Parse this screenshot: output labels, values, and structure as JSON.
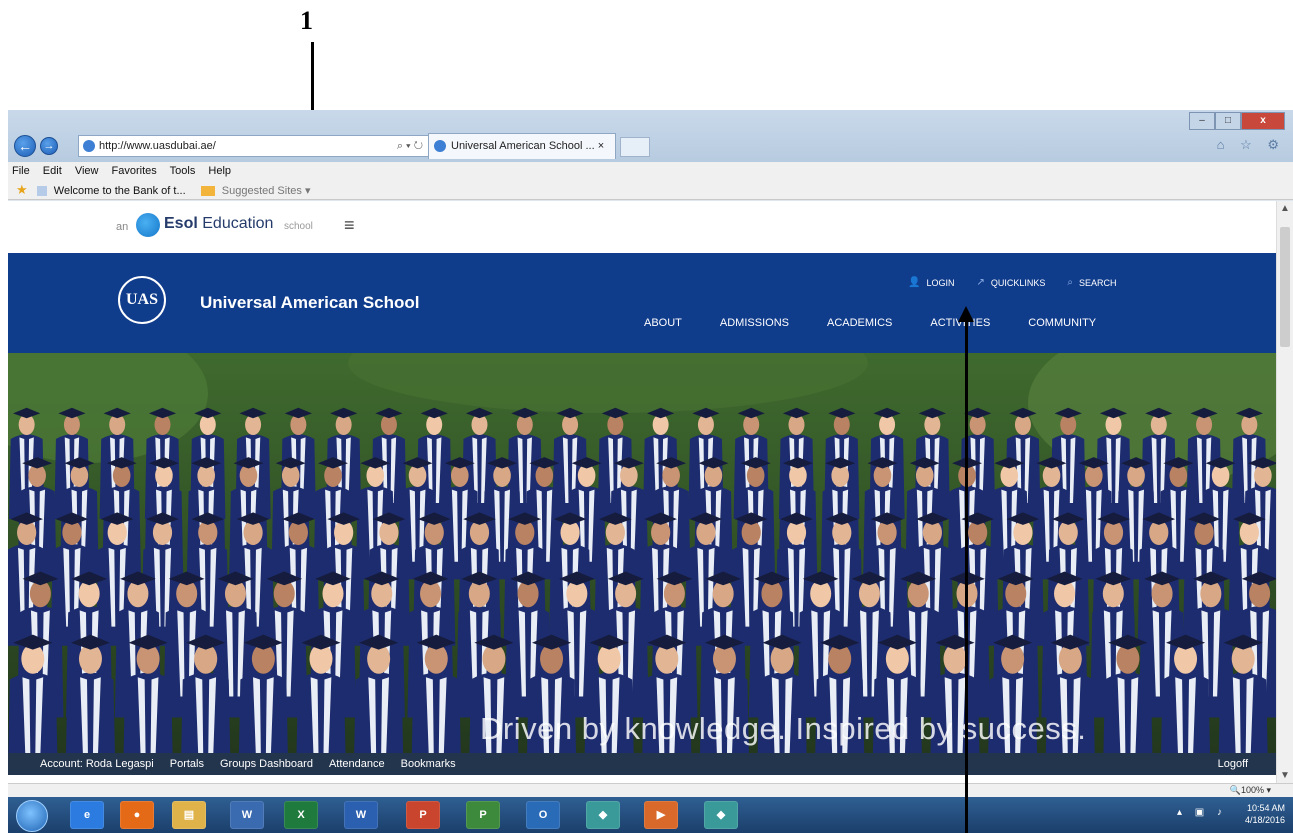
{
  "annotation": {
    "label": "1"
  },
  "browser": {
    "url": "http://www.uasdubai.ae/",
    "address_controls": "⌕ ▾ ↻",
    "tab_title": "Universal American School ... ×",
    "menu": [
      "File",
      "Edit",
      "View",
      "Favorites",
      "Tools",
      "Help"
    ],
    "favorites": [
      "Welcome to the Bank of t...",
      "Suggested Sites ▾"
    ],
    "window_controls": [
      "–",
      "□",
      "x"
    ],
    "right_icons": "⌂ ☆ ⚙",
    "zoom": "🔍100%  ▾"
  },
  "site": {
    "esol": {
      "prefix": "an",
      "brand_bold": "Esol",
      "brand_rest": "Education",
      "suffix": "school",
      "menu_icon": "≡"
    },
    "logo_text": "UAS",
    "school_name": "Universal American School",
    "utility_links": [
      {
        "icon": "user-icon",
        "glyph": "👤",
        "label": "LOGIN"
      },
      {
        "icon": "link-icon",
        "glyph": "↗",
        "label": "QUICKLINKS"
      },
      {
        "icon": "search-icon",
        "glyph": "⌕",
        "label": "SEARCH"
      }
    ],
    "main_nav": [
      "ABOUT",
      "ADMISSIONS",
      "ACADEMICS",
      "ACTIVITIES",
      "COMMUNITY"
    ],
    "tagline": "Driven by knowledge. Inspired by success.",
    "portal_links": [
      "Account: Roda Legaspi",
      "Portals",
      "Groups Dashboard",
      "Attendance",
      "Bookmarks"
    ],
    "logoff": "Logoff"
  },
  "taskbar": {
    "apps": [
      {
        "icon": "internet-explorer-icon",
        "glyph": "e"
      },
      {
        "icon": "firefox-icon",
        "glyph": "●"
      },
      {
        "icon": "folder-icon",
        "glyph": "▤"
      },
      {
        "icon": "word-legacy-icon",
        "glyph": "W"
      },
      {
        "icon": "excel-icon",
        "glyph": "X"
      },
      {
        "icon": "word-icon",
        "glyph": "W"
      },
      {
        "icon": "powerpoint-icon",
        "glyph": "P"
      },
      {
        "icon": "project-icon",
        "glyph": "P"
      },
      {
        "icon": "outlook-icon",
        "glyph": "O"
      },
      {
        "icon": "app-diamond-icon",
        "glyph": "◆"
      },
      {
        "icon": "media-icon",
        "glyph": "▶"
      },
      {
        "icon": "app-diamond-icon-2",
        "glyph": "◆"
      }
    ],
    "tray_icons": "▴ ▣ ♪",
    "time": "10:54 AM",
    "date": "4/18/2016"
  }
}
